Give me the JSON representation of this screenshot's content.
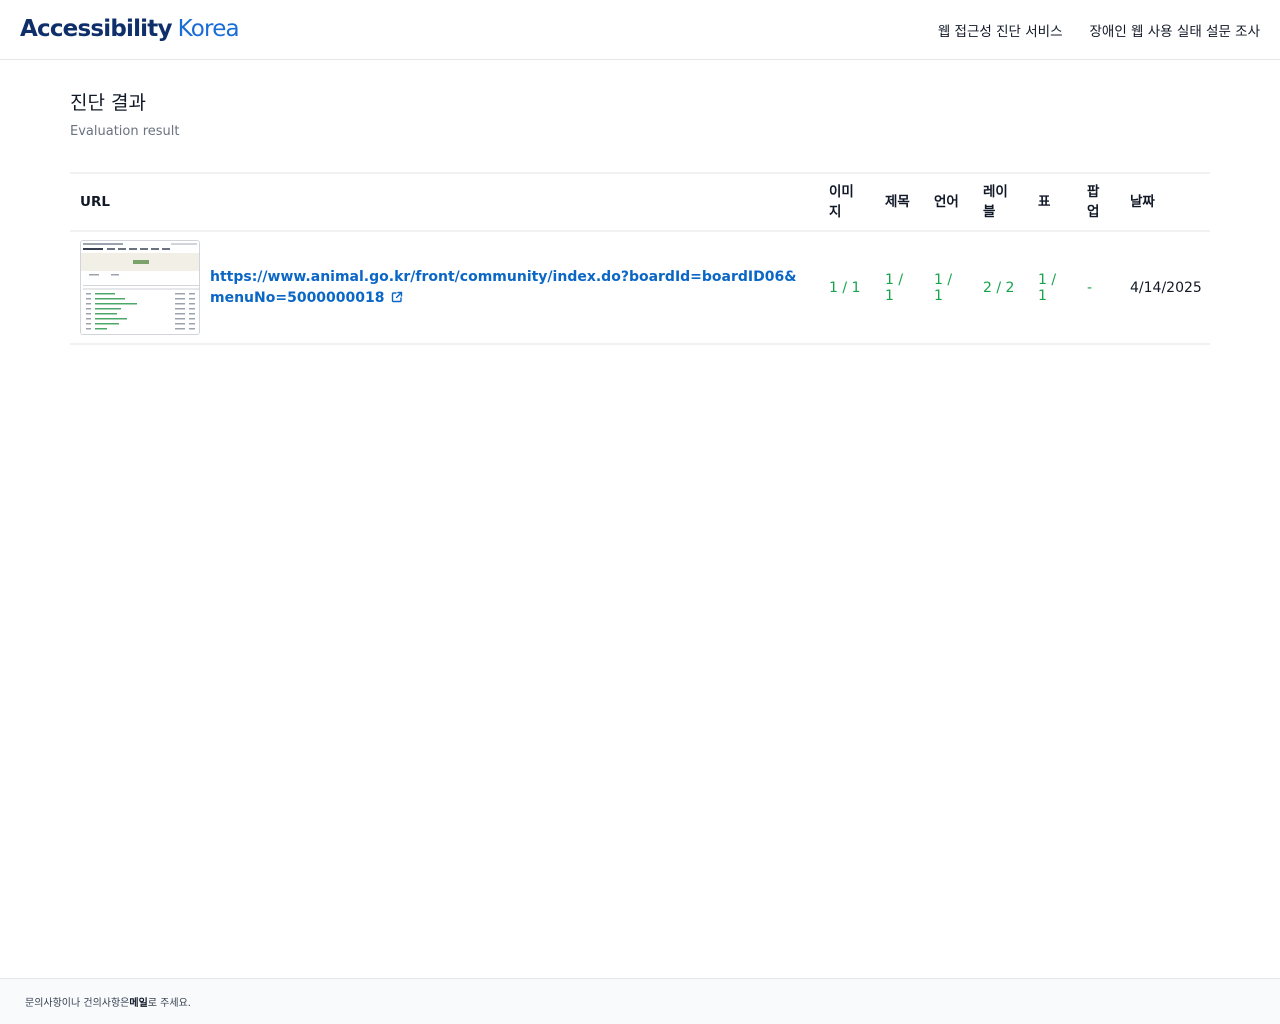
{
  "header": {
    "logo_part1": "Accessibility",
    "logo_part2": "Korea",
    "nav": [
      {
        "label": "웹 접근성 진단 서비스"
      },
      {
        "label": "장애인 웹 사용 실태 설문 조사"
      }
    ]
  },
  "main": {
    "title": "진단 결과",
    "subtitle": "Evaluation result"
  },
  "table": {
    "columns": {
      "url": "URL",
      "image": "이미지",
      "heading": "제목",
      "language": "언어",
      "label": "레이블",
      "table": "표",
      "popup": "팝업",
      "date": "날짜"
    },
    "rows": [
      {
        "url": "https://www.animal.go.kr/front/community/index.do?boardId=boardID06&menuNo=5000000018",
        "image": "1 / 1",
        "heading": "1 / 1",
        "language": "1 / 1",
        "label": "2 / 2",
        "table": "1 / 1",
        "popup": "-",
        "date": "4/14/2025"
      }
    ]
  },
  "footer": {
    "text_before": "문의사항이나 건의사항은 ",
    "link": "메일",
    "text_after": "로 주세요."
  },
  "colors": {
    "logo_dark": "#0f2f6b",
    "logo_blue": "#1a6cd6",
    "link": "#0b67c6",
    "score_green": "#16a34a"
  },
  "icons": {
    "external_link": "external-link-icon"
  }
}
